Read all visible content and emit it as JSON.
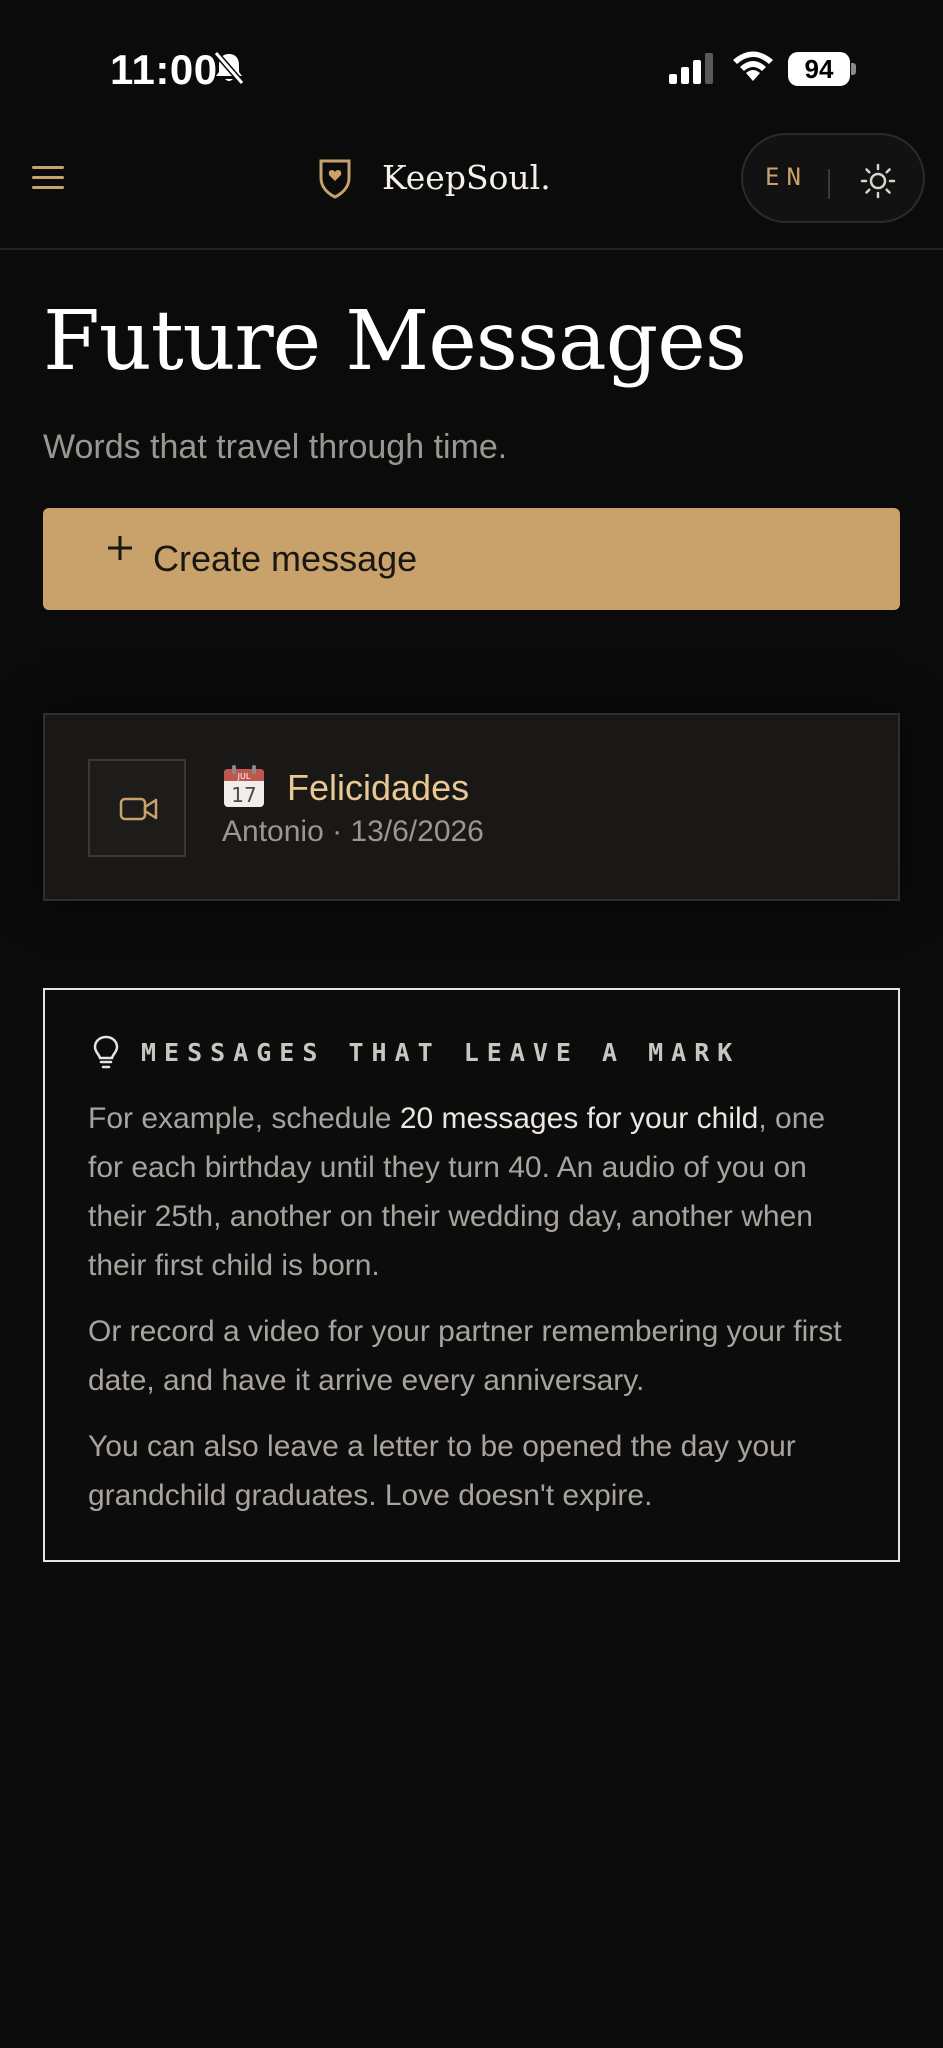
{
  "status_bar": {
    "time": "11:00",
    "battery": "94"
  },
  "header": {
    "brand": "KeepSoul.",
    "language": "EN"
  },
  "page": {
    "title": "Future Messages",
    "subtitle": "Words that travel through time."
  },
  "create_button": {
    "label": "Create message"
  },
  "messages": [
    {
      "title": "Felicidades",
      "meta": "Antonio · 13/6/2026",
      "calendar_month": "JUL",
      "calendar_day": "17",
      "type_icon": "video-camera-icon"
    }
  ],
  "info": {
    "heading": "MESSAGES THAT LEAVE A MARK",
    "p1_before": "For example, schedule ",
    "p1_bold": "20 messages for your child",
    "p1_after": ", one for each birthday until they turn 40. An audio of you on their 25th, another on their wedding day, another when their first child is born.",
    "p2": "Or record a video for your partner remembering your first date, and have it arrive every anniversary.",
    "p3": "You can also leave a letter to be opened the day your grandchild graduates. Love doesn't expire."
  },
  "colors": {
    "accent": "#c8a26a",
    "background": "#0b0b0b",
    "card": "#191817",
    "title_gold": "#e8c993"
  }
}
